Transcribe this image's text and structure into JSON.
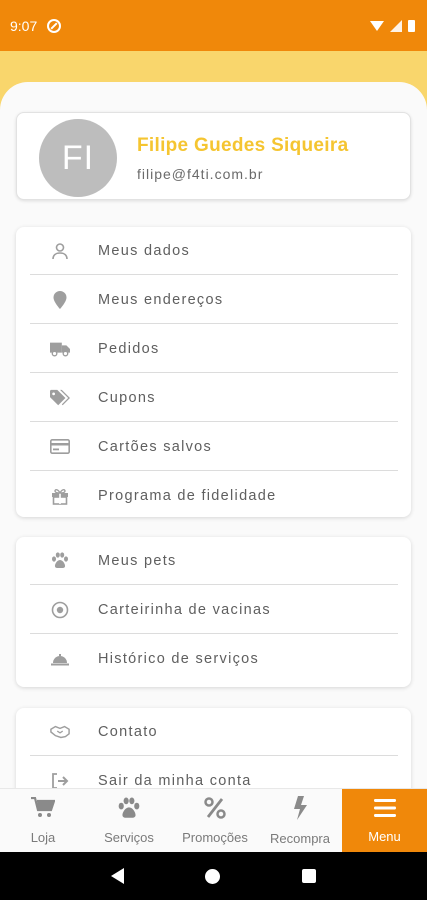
{
  "status_bar": {
    "time": "9:07"
  },
  "profile": {
    "initials": "FI",
    "name": "Filipe Guedes Siqueira",
    "email": "filipe@f4ti.com.br"
  },
  "account_menu": [
    {
      "label": "Meus dados",
      "icon": "person-icon"
    },
    {
      "label": "Meus endereços",
      "icon": "location-pin-icon"
    },
    {
      "label": "Pedidos",
      "icon": "truck-icon"
    },
    {
      "label": "Cupons",
      "icon": "tags-icon"
    },
    {
      "label": "Cartões salvos",
      "icon": "credit-card-icon"
    },
    {
      "label": "Programa de fidelidade",
      "icon": "gift-icon"
    }
  ],
  "pets_menu": [
    {
      "label": "Meus pets",
      "icon": "paw-icon"
    },
    {
      "label": "Carteirinha de vacinas",
      "icon": "vaccine-badge-icon"
    },
    {
      "label": "Histórico de serviços",
      "icon": "service-bell-icon"
    }
  ],
  "other_menu": [
    {
      "label": "Contato",
      "icon": "handshake-icon"
    },
    {
      "label": "Sair da minha conta",
      "icon": "logout-icon"
    }
  ],
  "bottom_nav": [
    {
      "label": "Loja",
      "icon": "cart-icon"
    },
    {
      "label": "Serviços",
      "icon": "paw-icon"
    },
    {
      "label": "Promoções",
      "icon": "percent-icon"
    },
    {
      "label": "Recompra",
      "icon": "bolt-icon"
    },
    {
      "label": "Menu",
      "icon": "hamburger-menu-icon",
      "active": true
    }
  ],
  "colors": {
    "primary": "#f0880a",
    "accent_yellow": "#f9d66c",
    "name_yellow": "#f5c531"
  }
}
